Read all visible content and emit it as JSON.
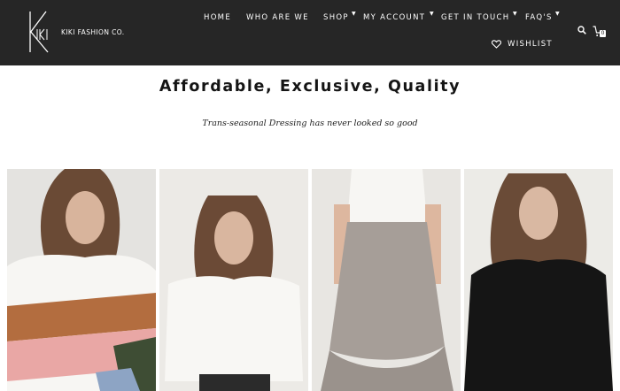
{
  "brand": {
    "name": "KIKI FASHION CO.",
    "mark_letters": "K"
  },
  "nav": {
    "items": [
      {
        "label": "HOME",
        "has_dropdown": false
      },
      {
        "label": "WHO ARE WE",
        "has_dropdown": false
      },
      {
        "label": "SHOP",
        "has_dropdown": true
      },
      {
        "label": "MY ACCOUNT",
        "has_dropdown": true
      },
      {
        "label": "GET IN TOUCH",
        "has_dropdown": true
      },
      {
        "label": "FAQ'S",
        "has_dropdown": true
      }
    ],
    "wishlist_label": "WISHLIST",
    "cart_count": "0",
    "icons": [
      "search-icon",
      "cart-icon",
      "heart-icon"
    ]
  },
  "hero": {
    "headline": "Affordable, Exclusive, Quality",
    "tagline": "Trans-seasonal Dressing has never looked so good"
  },
  "products": [
    {
      "name": "product-striped-knit-jumper",
      "colors": [
        "#ffffff",
        "#b36d3f",
        "#e9a7a5",
        "#3e4d34"
      ]
    },
    {
      "name": "product-white-cropped-knit",
      "colors": [
        "#f6f5f2",
        "#2b2b2b"
      ]
    },
    {
      "name": "product-printed-ruffle-skirt",
      "colors": [
        "#efeeea",
        "#9d9590"
      ]
    },
    {
      "name": "product-black-knit-jumper",
      "colors": [
        "#151515"
      ]
    }
  ],
  "colors": {
    "header_bg": "#262626",
    "header_text": "#ffffff",
    "page_bg": "#ffffff",
    "text_dark": "#151515"
  }
}
